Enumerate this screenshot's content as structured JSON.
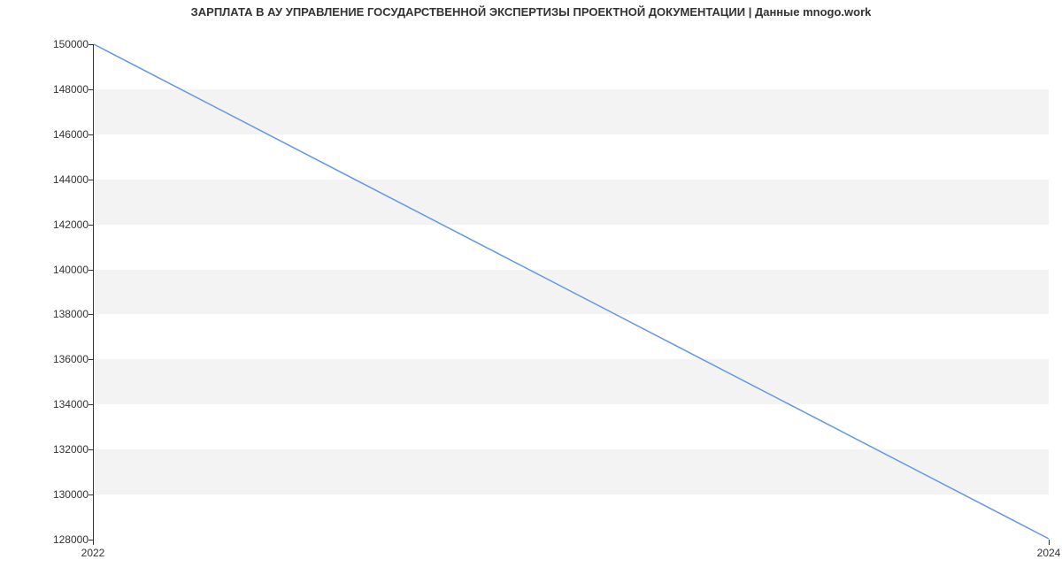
{
  "chart_data": {
    "type": "line",
    "title": "ЗАРПЛАТА В АУ УПРАВЛЕНИЕ ГОСУДАРСТВЕННОЙ ЭКСПЕРТИЗЫ ПРОЕКТНОЙ ДОКУМЕНТАЦИИ | Данные mnogo.work",
    "xlabel": "",
    "ylabel": "",
    "x": [
      2022,
      2024
    ],
    "x_ticks": [
      2022,
      2024
    ],
    "y_ticks": [
      128000,
      130000,
      132000,
      134000,
      136000,
      138000,
      140000,
      142000,
      144000,
      146000,
      148000,
      150000
    ],
    "ylim": [
      128000,
      150000
    ],
    "xlim": [
      2022,
      2024
    ],
    "series": [
      {
        "name": "salary",
        "values": [
          150000,
          128000
        ]
      }
    ],
    "line_color": "#6495ED",
    "band_odd_color": "#f3f3f3"
  }
}
